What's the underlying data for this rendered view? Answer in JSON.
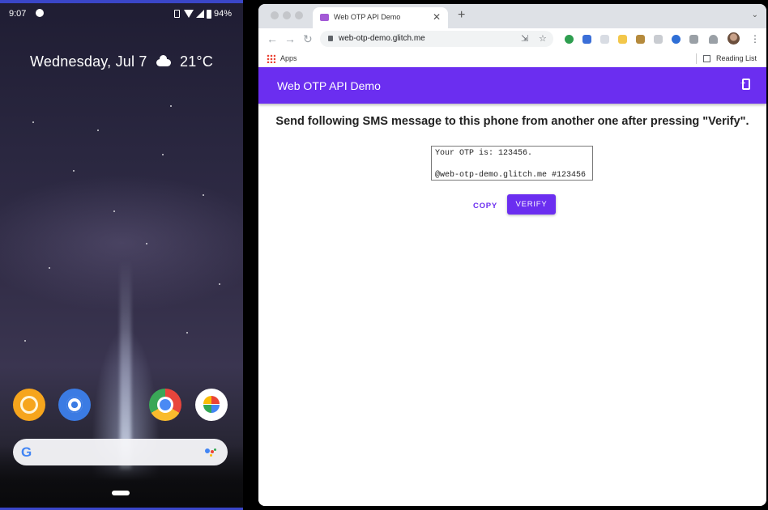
{
  "phone": {
    "status_time": "9:07",
    "battery": "94%",
    "weather_text": "Wednesday, Jul 7",
    "temperature": "21°C",
    "apps": [
      "amber-app-icon",
      "settings-icon",
      "chrome-icon",
      "photos-icon"
    ],
    "search_logo": "G"
  },
  "browser": {
    "tab_title": "Web OTP API Demo",
    "url": "web-otp-demo.glitch.me",
    "bookmarks_apps": "Apps",
    "reading_list": "Reading List"
  },
  "page": {
    "appbar_title": "Web OTP API Demo",
    "instruction": "Send following SMS message to this phone from another one after pressing \"Verify\".",
    "sms_text": "Your OTP is: 123456.\n\n@web-otp-demo.glitch.me #123456",
    "copy_label": "COPY",
    "verify_label": "VERIFY",
    "accent_color": "#6b2ef0"
  }
}
